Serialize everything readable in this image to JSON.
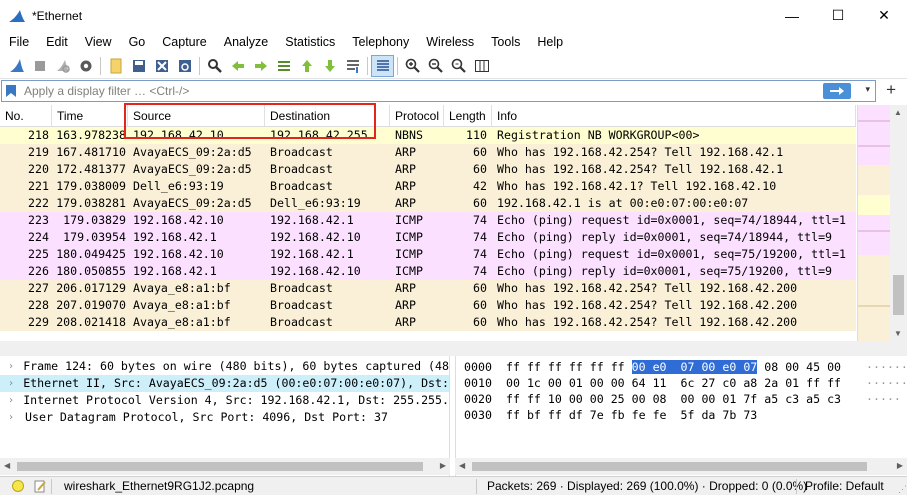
{
  "window": {
    "title": "*Ethernet",
    "min_label": "—",
    "max_label": "☐",
    "close_label": "✕"
  },
  "menu": [
    "File",
    "Edit",
    "View",
    "Go",
    "Capture",
    "Analyze",
    "Statistics",
    "Telephony",
    "Wireless",
    "Tools",
    "Help"
  ],
  "toolbar_icons": [
    "shark-fin-start-icon",
    "stop-icon",
    "restart-icon",
    "options-gear-icon",
    "open-file-icon",
    "save-file-icon",
    "close-file-icon",
    "reload-icon",
    "find-icon",
    "back-icon",
    "forward-icon",
    "go-to-packet-icon",
    "first-packet-icon",
    "last-packet-icon",
    "autoscroll-icon",
    "colorize-icon",
    "zoom-in-icon",
    "zoom-out-icon",
    "zoom-reset-icon",
    "resize-columns-icon"
  ],
  "filter": {
    "placeholder": "Apply a display filter … <Ctrl-/>",
    "plus": "+",
    "dropdown": "▾"
  },
  "packet_list": {
    "columns": [
      "No.",
      "Time",
      "Source",
      "Destination",
      "Protocol",
      "Length",
      "Info"
    ],
    "rows": [
      {
        "no": "218",
        "time": "163.978238",
        "src": "192.168.42.10",
        "dst": "192.168.42.255",
        "proto": "NBNS",
        "len": "110",
        "info": "Registration NB WORKGROUP<00>",
        "kind": "nbns"
      },
      {
        "no": "219",
        "time": "167.481710",
        "src": "AvayaECS_09:2a:d5",
        "dst": "Broadcast",
        "proto": "ARP",
        "len": "60",
        "info": "Who has 192.168.42.254? Tell 192.168.42.1",
        "kind": "arp"
      },
      {
        "no": "220",
        "time": "172.481377",
        "src": "AvayaECS_09:2a:d5",
        "dst": "Broadcast",
        "proto": "ARP",
        "len": "60",
        "info": "Who has 192.168.42.254? Tell 192.168.42.1",
        "kind": "arp"
      },
      {
        "no": "221",
        "time": "179.038009",
        "src": "Dell_e6:93:19",
        "dst": "Broadcast",
        "proto": "ARP",
        "len": "42",
        "info": "Who has 192.168.42.1? Tell 192.168.42.10",
        "kind": "arp"
      },
      {
        "no": "222",
        "time": "179.038281",
        "src": "AvayaECS_09:2a:d5",
        "dst": "Dell_e6:93:19",
        "proto": "ARP",
        "len": "60",
        "info": "192.168.42.1 is at 00:e0:07:00:e0:07",
        "kind": "arp"
      },
      {
        "no": "223",
        "time": "179.03829",
        "src": "192.168.42.10",
        "dst": "192.168.42.1",
        "proto": "ICMP",
        "len": "74",
        "info": "Echo (ping) request  id=0x0001, seq=74/18944, ttl=1",
        "kind": "icmp"
      },
      {
        "no": "224",
        "time": "179.03954",
        "src": "192.168.42.1",
        "dst": "192.168.42.10",
        "proto": "ICMP",
        "len": "74",
        "info": "Echo (ping) reply    id=0x0001, seq=74/18944, ttl=9",
        "kind": "icmp"
      },
      {
        "no": "225",
        "time": "180.049425",
        "src": "192.168.42.10",
        "dst": "192.168.42.1",
        "proto": "ICMP",
        "len": "74",
        "info": "Echo (ping) request  id=0x0001, seq=75/19200, ttl=1",
        "kind": "icmp"
      },
      {
        "no": "226",
        "time": "180.050855",
        "src": "192.168.42.1",
        "dst": "192.168.42.10",
        "proto": "ICMP",
        "len": "74",
        "info": "Echo (ping) reply    id=0x0001, seq=75/19200, ttl=9",
        "kind": "icmp"
      },
      {
        "no": "227",
        "time": "206.017129",
        "src": "Avaya_e8:a1:bf",
        "dst": "Broadcast",
        "proto": "ARP",
        "len": "60",
        "info": "Who has 192.168.42.254? Tell 192.168.42.200",
        "kind": "arp"
      },
      {
        "no": "228",
        "time": "207.019070",
        "src": "Avaya_e8:a1:bf",
        "dst": "Broadcast",
        "proto": "ARP",
        "len": "60",
        "info": "Who has 192.168.42.254? Tell 192.168.42.200",
        "kind": "arp"
      },
      {
        "no": "229",
        "time": "208.021418",
        "src": "Avaya_e8:a1:bf",
        "dst": "Broadcast",
        "proto": "ARP",
        "len": "60",
        "info": "Who has 192.168.42.254? Tell 192.168.42.200",
        "kind": "arp"
      }
    ]
  },
  "details": [
    {
      "text": "Frame 124: 60 bytes on wire (480 bits), 60 bytes captured (48",
      "selected": false
    },
    {
      "text": "Ethernet II, Src: AvayaECS_09:2a:d5 (00:e0:07:00:e0:07), Dst:",
      "selected": true
    },
    {
      "text": "Internet Protocol Version 4, Src: 192.168.42.1, Dst: 255.255.",
      "selected": false
    },
    {
      "text": "User Datagram Protocol, Src Port: 4096, Dst Port: 37",
      "selected": false
    }
  ],
  "bytes": [
    {
      "offset": "0000",
      "pre": "ff ff ff ff ff ff ",
      "hl": "00 e0  07 00 e0 07",
      "post": " 08 00 45 00",
      "ascii": "······"
    },
    {
      "offset": "0010",
      "pre": "00 1c 00 01 00 00 64 11  6c 27 c0 a8 2a 01 ff ff",
      "hl": "",
      "post": "",
      "ascii": "······"
    },
    {
      "offset": "0020",
      "pre": "ff ff 10 00 00 25 00 08  00 00 01 7f a5 c3 a5 c3",
      "hl": "",
      "post": "",
      "ascii": "·····"
    },
    {
      "offset": "0030",
      "pre": "ff bf ff df 7e fb fe fe  5f da 7b 73",
      "hl": "",
      "post": "",
      "ascii": ""
    }
  ],
  "status": {
    "file": "wireshark_Ethernet9RG1J2.pcapng",
    "packets": "Packets: 269 · Displayed: 269 (100.0%) · Dropped: 0 (0.0%)",
    "profile": "Profile: Default"
  },
  "colors": {
    "nbns": "#fefed0",
    "arp": "#faf0d7",
    "icmp": "#fce0ff",
    "highlight": "#e0261d",
    "selected_detail": "#cceffa"
  }
}
